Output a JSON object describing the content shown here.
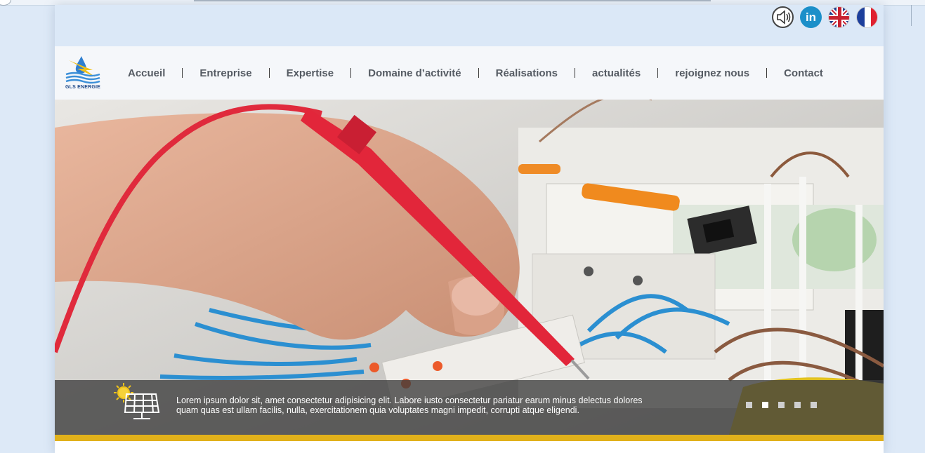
{
  "header": {
    "social": [
      {
        "name": "speaker-icon"
      },
      {
        "name": "linkedin-icon",
        "label": "in"
      },
      {
        "name": "uk-flag-icon"
      },
      {
        "name": "france-flag-icon"
      }
    ],
    "logo_text": "GLS ENERGIE"
  },
  "nav": {
    "items": [
      {
        "label": "Accueil"
      },
      {
        "label": "Entreprise"
      },
      {
        "label": "Expertise"
      },
      {
        "label": "Domaine d’activité"
      },
      {
        "label": "Réalisations"
      },
      {
        "label": "actualités"
      },
      {
        "label": "rejoignez nous"
      },
      {
        "label": "Contact"
      }
    ]
  },
  "slider": {
    "caption_line1": "Lorem ipsum dolor sit, amet consectetur adipisicing elit. Labore iusto consectetur pariatur earum minus delectus dolores",
    "caption_line2": "quam quas est ullam facilis, nulla, exercitationem quia voluptates magni impedit, corrupti atque eligendi.",
    "slide_count": 5,
    "active_slide": 2
  },
  "colors": {
    "accent_yellow": "#e1b11b",
    "nav_text": "#555b63",
    "linkedin_blue": "#1b8fc9"
  }
}
